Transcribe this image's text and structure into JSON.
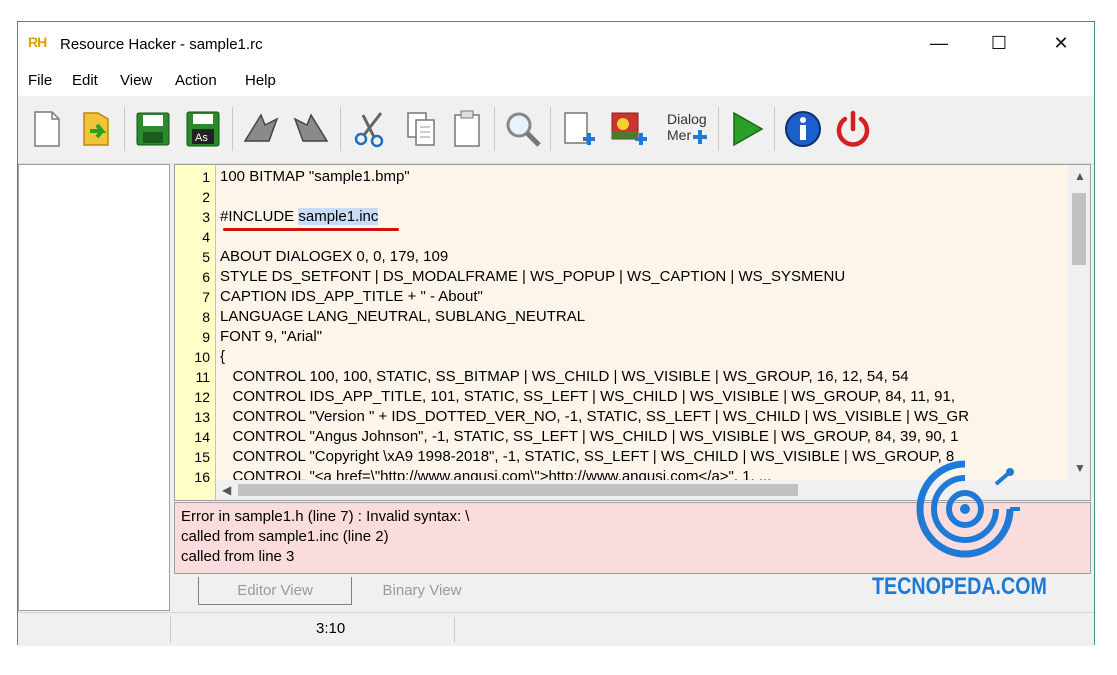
{
  "window": {
    "title": "Resource Hacker - sample1.rc",
    "icon_text_a": "R",
    "icon_text_b": "H",
    "minimize_glyph": "—",
    "maximize_glyph": "☐",
    "close_glyph": "✕"
  },
  "menu": [
    "File",
    "Edit",
    "View",
    "Action",
    "Help"
  ],
  "toolbar": {
    "buttons": [
      "new-file-icon",
      "open-file-icon",
      "save-icon",
      "save-as-icon",
      "back-icon",
      "forward-icon",
      "cut-icon",
      "copy-icon",
      "paste-icon",
      "find-icon",
      "add-resource-icon",
      "add-image-icon",
      "dialog-menu-icon",
      "compile-run-icon",
      "info-icon",
      "exit-icon"
    ],
    "save_as_label": "As",
    "dialog_label_1": "Dialog",
    "dialog_label_2": "Mer"
  },
  "editor": {
    "line_numbers": [
      "1",
      "2",
      "3",
      "4",
      "5",
      "6",
      "7",
      "8",
      "9",
      "10",
      "11",
      "12",
      "13",
      "14",
      "15",
      "16"
    ],
    "lines": [
      "100 BITMAP \"sample1.bmp\"",
      "",
      "",
      "",
      "ABOUT DIALOGEX 0, 0, 179, 109",
      "STYLE DS_SETFONT | DS_MODALFRAME | WS_POPUP | WS_CAPTION | WS_SYSMENU",
      "CAPTION IDS_APP_TITLE + \" - About\"",
      "LANGUAGE LANG_NEUTRAL, SUBLANG_NEUTRAL",
      "FONT 9, \"Arial\"",
      "{",
      "   CONTROL 100, 100, STATIC, SS_BITMAP | WS_CHILD | WS_VISIBLE | WS_GROUP, 16, 12, 54, 54",
      "   CONTROL IDS_APP_TITLE, 101, STATIC, SS_LEFT | WS_CHILD | WS_VISIBLE | WS_GROUP, 84, 11, 91,",
      "   CONTROL \"Version \" + IDS_DOTTED_VER_NO, -1, STATIC, SS_LEFT | WS_CHILD | WS_VISIBLE | WS_GR",
      "   CONTROL \"Angus Johnson\", -1, STATIC, SS_LEFT | WS_CHILD | WS_VISIBLE | WS_GROUP, 84, 39, 90, 1",
      "   CONTROL \"Copyright \\xA9 1998-2018\", -1, STATIC, SS_LEFT | WS_CHILD | WS_VISIBLE | WS_GROUP, 8",
      "   CONTROL \"<a href=\\\"http://www.angusj.com\\\">http://www.angusj.com</a>\", 1, ..."
    ],
    "include_prefix": "#INCLUDE ",
    "include_target": "sample1.inc"
  },
  "messages": [
    "Error in sample1.h (line 7) : Invalid syntax: \\",
    "called from sample1.inc (line 2)",
    "called from line 3"
  ],
  "tabs": {
    "editor": "Editor View",
    "binary": "Binary View"
  },
  "status": {
    "position": "3:10"
  },
  "watermark": {
    "text": "TECNOPEDA.COM",
    "color": "#1e7ad4"
  }
}
